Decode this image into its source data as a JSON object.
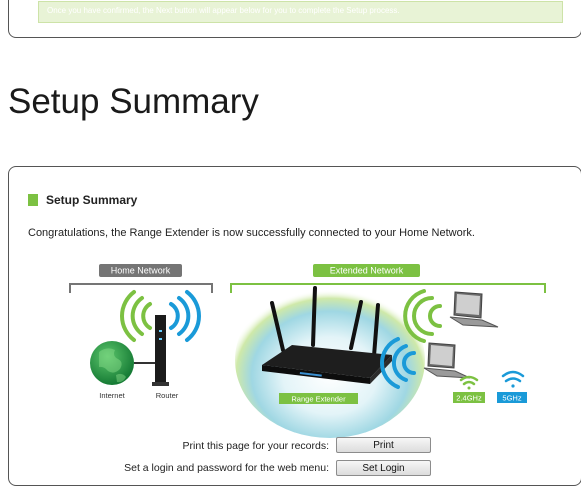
{
  "top": {
    "note": "Once you have confirmed, the Next button will appear below for you to complete the Setup process."
  },
  "page_title": "Setup Summary",
  "card": {
    "heading": "Setup Summary",
    "message": "Congratulations, the Range Extender is now successfully connected to your Home Network."
  },
  "diagram": {
    "home_network_label": "Home Network",
    "extended_network_label": "Extended Network",
    "internet_label": "Internet",
    "router_label": "Router",
    "range_extender_label": "Range Extender",
    "band_24_label": "2.4GHz",
    "band_5_label": "5GHz",
    "colors": {
      "home_header": "#757575",
      "extended_header": "#7cc142",
      "wifi_green": "#7cc142",
      "wifi_blue": "#1a9ad8",
      "globe": "#27a04a"
    }
  },
  "actions": {
    "print_label": "Print this page for your records:",
    "print_button": "Print",
    "login_label": "Set a login and password for the web menu:",
    "login_button": "Set Login"
  }
}
